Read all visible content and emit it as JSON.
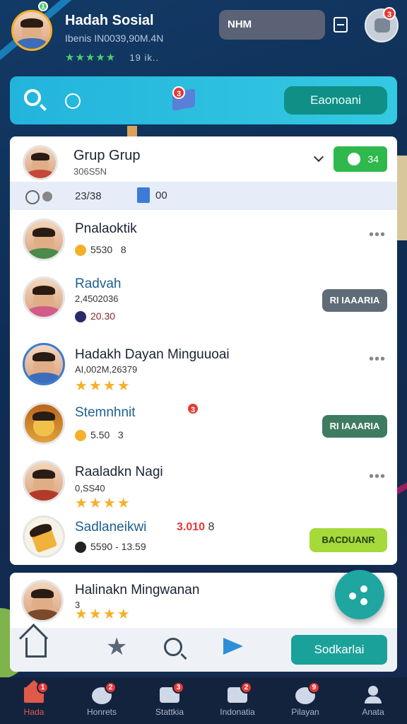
{
  "header": {
    "name": "Hadah Sosial",
    "subtitle": "Ibenis IN0039,90M.4N",
    "stars": "★★★★★",
    "count": "19 ik..",
    "pill_label": "NHM",
    "notif_badge": "3",
    "online_badge": "1"
  },
  "search": {
    "button_label": "Eaonoani",
    "box_badge": "3"
  },
  "group": {
    "title": "Grup Grup",
    "subtitle": "306S5N",
    "toggle_label": "34",
    "info_count": "23/38",
    "info_likes": "00"
  },
  "rows": [
    {
      "name": "Pnalaoktik",
      "meta": "5530",
      "meta2": "8"
    },
    {
      "name": "Radvah",
      "meta": "2,4502036",
      "meta2": "20.30",
      "button": "RI IAAARIA"
    },
    {
      "name": "Hadakh Dayan Minguuoai",
      "meta": "AI,002M,26379",
      "stars": "★★★★"
    },
    {
      "name": "Stemnhnit",
      "meta": "5.50",
      "meta2": "3",
      "button": "RI IAAARIA",
      "badge": "3"
    },
    {
      "name": "Raaladkn Nagi",
      "meta": "0,SS40",
      "stars": "★★★★"
    },
    {
      "name": "Sadlaneikwi",
      "meta": "5590 - 13.59",
      "amount": "3.010",
      "amount_suffix": "8",
      "button": "BACDUANR"
    }
  ],
  "bottom": {
    "name": "Halinakn Mingwanan",
    "meta": "3",
    "stars": "★★★★",
    "button_label": "Sodkarlai"
  },
  "tabs": [
    {
      "label": "Hada",
      "badge": "1"
    },
    {
      "label": "Honrets",
      "badge": "2"
    },
    {
      "label": "Stattkia",
      "badge": "3"
    },
    {
      "label": "Indonatia",
      "badge": "2"
    },
    {
      "label": "Pilayan",
      "badge": "9"
    },
    {
      "label": "Anata"
    }
  ],
  "colors": {
    "accent": "#23b4dc",
    "primary_button": "#0f8f86",
    "star": "#f5b02a",
    "badge": "#e53935",
    "active_tab": "#e05a4a"
  }
}
